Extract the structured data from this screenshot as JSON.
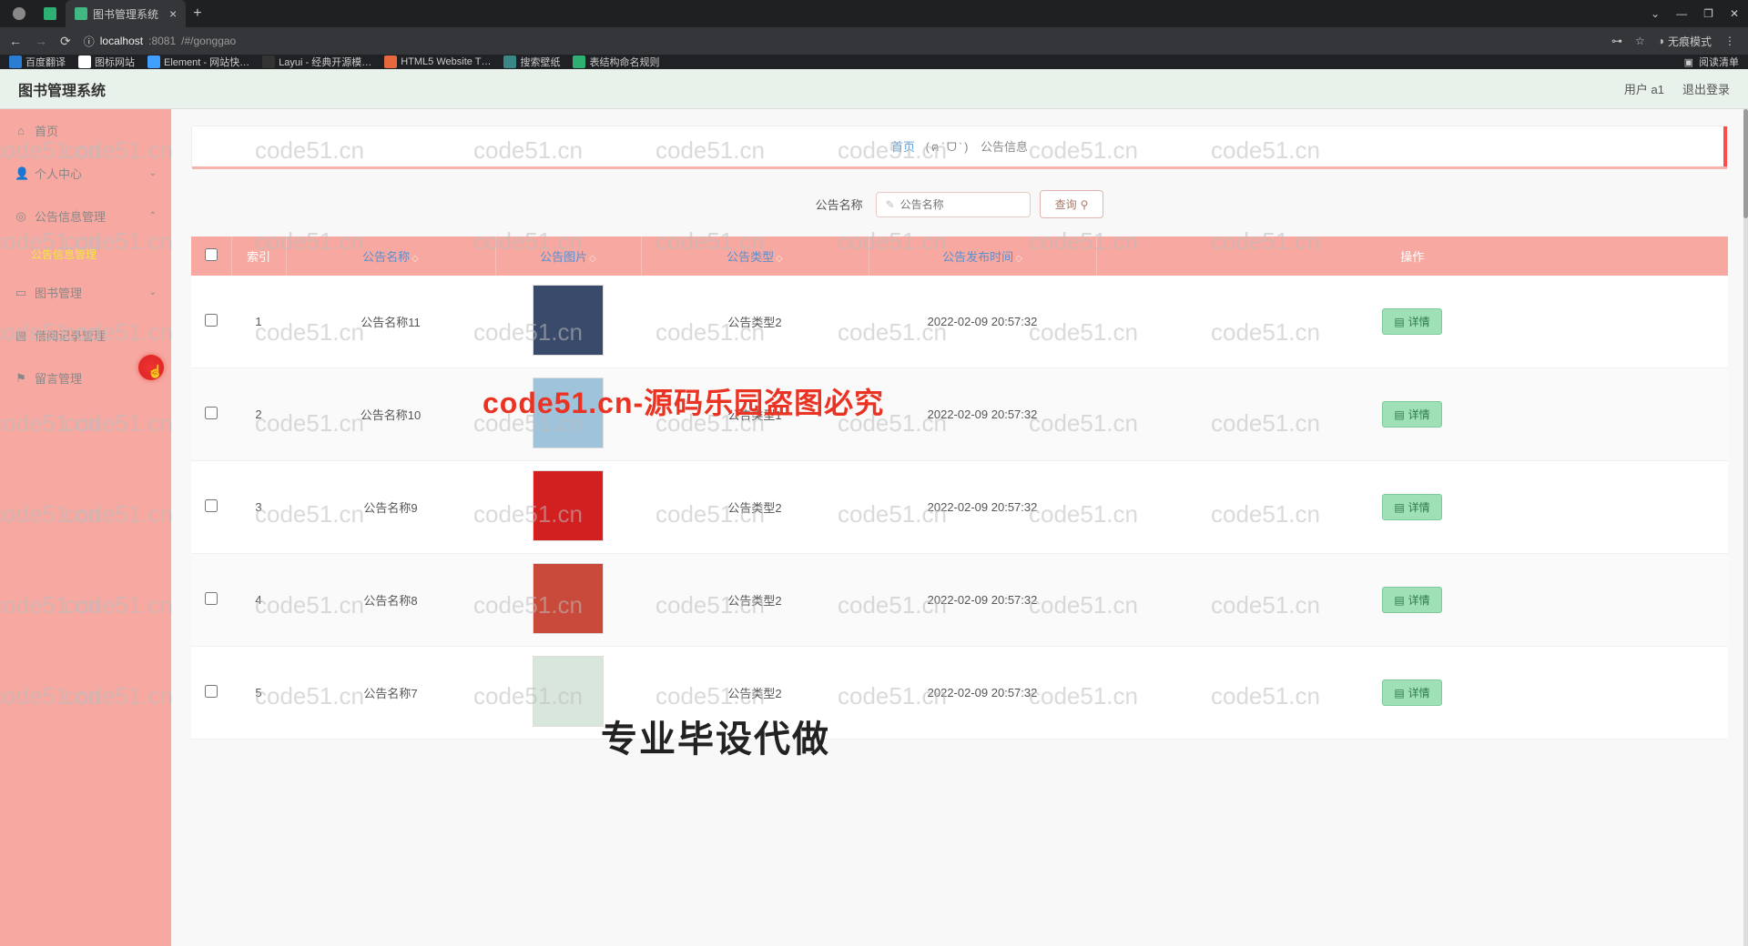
{
  "browser": {
    "tabs": [
      {
        "title": "",
        "icon": "globe"
      },
      {
        "title": "",
        "icon": "green"
      },
      {
        "title": "图书管理系统",
        "icon": "v",
        "active": true
      }
    ],
    "close": "×",
    "add": "+",
    "window_controls": {
      "drop": "⌄",
      "min": "—",
      "max": "❐",
      "close": "✕"
    },
    "nav": {
      "back": "←",
      "fwd": "→",
      "reload": "⟳",
      "lock": "ⓘ"
    },
    "url_host": "localhost",
    "url_port": ":8081",
    "url_path": "/#/gonggao",
    "right": {
      "key": "⊶",
      "star": "☆",
      "incog_icon": "◑",
      "incog_label": "无痕模式",
      "menu": "⋮"
    },
    "bookmarks": [
      {
        "cls": "b1",
        "label": "百度翻译"
      },
      {
        "cls": "b2",
        "label": "图标网站"
      },
      {
        "cls": "b3",
        "label": "Element - 网站快…"
      },
      {
        "cls": "b4",
        "label": "Layui - 经典开源模…"
      },
      {
        "cls": "b5",
        "label": "HTML5 Website T…"
      },
      {
        "cls": "b6",
        "label": "搜索壁纸"
      },
      {
        "cls": "b7",
        "label": "表结构命名规则"
      }
    ],
    "reading_list": {
      "icon": "▣",
      "label": "阅读清单"
    }
  },
  "header": {
    "title": "图书管理系统",
    "user_label": "用户 a1",
    "logout": "退出登录"
  },
  "sidebar": {
    "items": [
      {
        "icon": "⌂",
        "label": "首页",
        "expandable": false
      },
      {
        "icon": "👤",
        "label": "个人中心",
        "expandable": true,
        "chev": "⌄"
      },
      {
        "icon": "◎",
        "label": "公告信息管理",
        "expandable": true,
        "chev": "⌃",
        "sub": [
          {
            "label": "公告信息管理",
            "active": true
          }
        ]
      },
      {
        "icon": "▭",
        "label": "图书管理",
        "expandable": true,
        "chev": "⌄"
      },
      {
        "icon": "▤",
        "label": "借阅记录管理",
        "expandable": false
      },
      {
        "icon": "⚑",
        "label": "留言管理",
        "expandable": false
      }
    ]
  },
  "breadcrumb": {
    "home": "首页",
    "ears": "(ฅˊᗜˋ)",
    "current": "公告信息"
  },
  "search": {
    "label": "公告名称",
    "placeholder": "公告名称",
    "icon": "✎",
    "btn_label": "查询",
    "btn_icon": "⚲"
  },
  "table": {
    "columns": {
      "check": "",
      "index": "索引",
      "name": "公告名称",
      "image": "公告图片",
      "type": "公告类型",
      "pubtime": "公告发布时间",
      "action": "操作"
    },
    "rows": [
      {
        "idx": "1",
        "name": "公告名称11",
        "type": "公告类型2",
        "time": "2022-02-09 20:57:32",
        "img": "#3a4a6a"
      },
      {
        "idx": "2",
        "name": "公告名称10",
        "type": "公告类型1",
        "time": "2022-02-09 20:57:32",
        "img": "#9ec3da"
      },
      {
        "idx": "3",
        "name": "公告名称9",
        "type": "公告类型2",
        "time": "2022-02-09 20:57:32",
        "img": "#d21f1f"
      },
      {
        "idx": "4",
        "name": "公告名称8",
        "type": "公告类型2",
        "time": "2022-02-09 20:57:32",
        "img": "#c94a3b"
      },
      {
        "idx": "5",
        "name": "公告名称7",
        "type": "公告类型2",
        "time": "2022-02-09 20:57:32",
        "img": "#d9e6dc"
      }
    ],
    "detail_btn": "详情",
    "detail_icon": "▤"
  },
  "watermarks": {
    "grey": "code51.cn",
    "red": "code51.cn-源码乐园盗图必究",
    "black": "专业毕设代做"
  }
}
